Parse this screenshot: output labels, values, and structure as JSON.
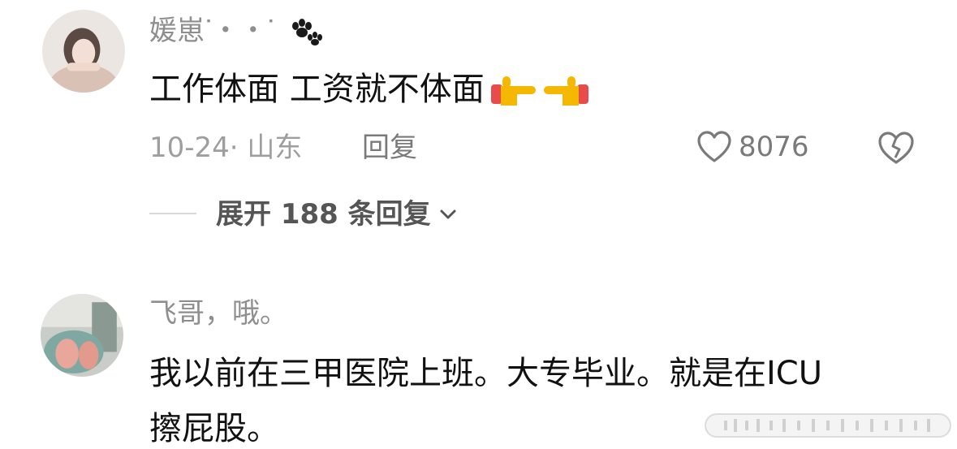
{
  "comments": [
    {
      "username": "媛崽",
      "username_suffix": "ᐝ・・ᐝ",
      "text": "工作体面 工资就不体面",
      "emoji": [
        "backhand-pointing-right",
        "backhand-pointing-right"
      ],
      "date_location": "10-24· 山东",
      "reply_label": "回复",
      "likes": "8076",
      "expand_label": "展开 188 条回复"
    },
    {
      "username": "飞哥，哦。",
      "text_line1": "我以前在三甲医院上班。大专毕业。就是在ICU",
      "text_line2": "擦屁股。"
    }
  ],
  "icons": {
    "like": "heart-outline-icon",
    "dislike": "broken-heart-icon",
    "expand": "chevron-down-icon",
    "username_decoration": "paw-prints-icon"
  },
  "colors": {
    "username": "#8e8e8e",
    "text": "#111111",
    "meta": "#9e9e9e",
    "emoji": "#f5b800"
  }
}
